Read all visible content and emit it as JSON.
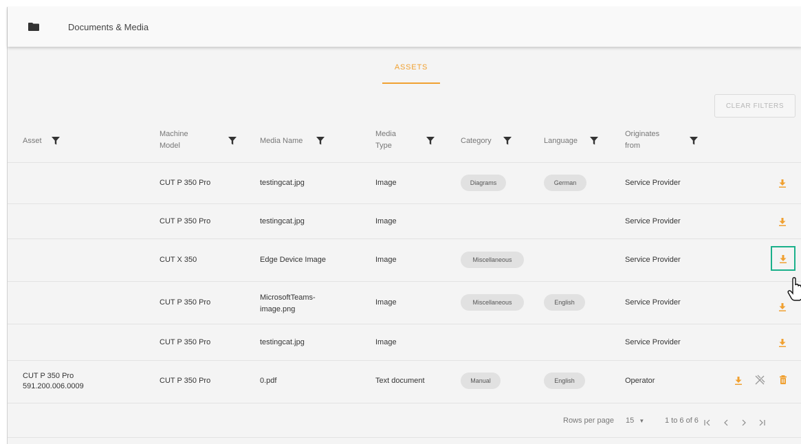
{
  "header": {
    "title": "Documents & Media",
    "icon": "folder-icon"
  },
  "tabs": [
    {
      "label": "ASSETS",
      "active": true
    }
  ],
  "clear_filters_label": "CLEAR FILTERS",
  "columns": {
    "asset": "Asset",
    "machine_model": [
      "Machine",
      "Model"
    ],
    "media_name": "Media Name",
    "media_type": [
      "Media",
      "Type"
    ],
    "category": "Category",
    "language": "Language",
    "originates_from": [
      "Originates",
      "from"
    ]
  },
  "rows": [
    {
      "asset": [
        "",
        ""
      ],
      "machine_model": "CUT P 350 Pro",
      "media_name": [
        "testingcat.jpg",
        ""
      ],
      "media_type": "Image",
      "category": "Diagrams",
      "language": "German",
      "originates_from": "Service Provider",
      "actions": [
        "download"
      ]
    },
    {
      "asset": [
        "",
        ""
      ],
      "machine_model": "CUT P 350 Pro",
      "media_name": [
        "testingcat.jpg",
        ""
      ],
      "media_type": "Image",
      "category": "",
      "language": "",
      "originates_from": "Service Provider",
      "actions": [
        "download"
      ]
    },
    {
      "asset": [
        "",
        ""
      ],
      "machine_model": "CUT X 350",
      "media_name": [
        "Edge Device Image",
        ""
      ],
      "media_type": "Image",
      "category": "Miscellaneous",
      "language": "",
      "originates_from": "Service Provider",
      "actions": [
        "download"
      ]
    },
    {
      "asset": [
        "",
        ""
      ],
      "machine_model": "CUT P 350 Pro",
      "media_name": [
        "MicrosoftTeams-",
        "image.png"
      ],
      "media_type": "Image",
      "category": "Miscellaneous",
      "language": "English",
      "originates_from": "Service Provider",
      "actions": [
        "download"
      ]
    },
    {
      "asset": [
        "",
        ""
      ],
      "machine_model": "CUT P 350 Pro",
      "media_name": [
        "testingcat.jpg",
        ""
      ],
      "media_type": "Image",
      "category": "",
      "language": "",
      "originates_from": "Service Provider",
      "actions": [
        "download"
      ]
    },
    {
      "asset": [
        "CUT P 350 Pro",
        "591.200.006.0009"
      ],
      "machine_model": "CUT P 350 Pro",
      "media_name": [
        "0.pdf",
        ""
      ],
      "media_type": "Text document",
      "category": "Manual",
      "language": "English",
      "originates_from": "Operator",
      "actions": [
        "download",
        "unlink",
        "delete"
      ]
    }
  ],
  "pagination": {
    "rows_per_page_label": "Rows per page",
    "rows_per_page_value": "15",
    "range_text": "1 to 6 of 6"
  },
  "colors": {
    "accent": "#f0a030",
    "highlight": "#1ab08a",
    "chip": "#e1e1e1"
  }
}
